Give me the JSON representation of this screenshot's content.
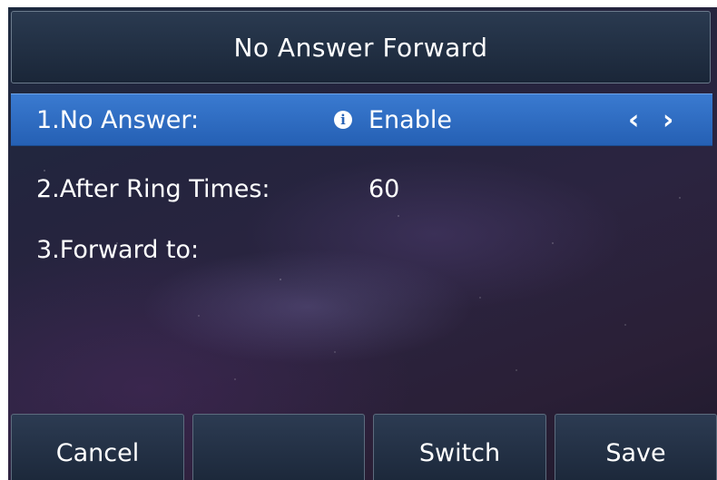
{
  "title": "No Answer Forward",
  "rows": [
    {
      "label": "1.No Answer:",
      "value": "Enable",
      "selected": true,
      "has_info_icon": true,
      "has_arrows": true,
      "arrow_left": "‹",
      "arrow_right": "›"
    },
    {
      "label": "2.After Ring Times:",
      "value": "60"
    },
    {
      "label": "3.Forward to:",
      "value": ""
    }
  ],
  "softkeys": [
    "Cancel",
    "",
    "Switch",
    "Save"
  ],
  "icons": {
    "info": "info-icon",
    "info_glyph": "i",
    "left": "chevron-left-icon",
    "right": "chevron-right-icon"
  },
  "colors": {
    "selected_row": "#2f6dc4",
    "title_bar": "#22314a",
    "softkey": "#23324a",
    "text": "#ffffff"
  }
}
